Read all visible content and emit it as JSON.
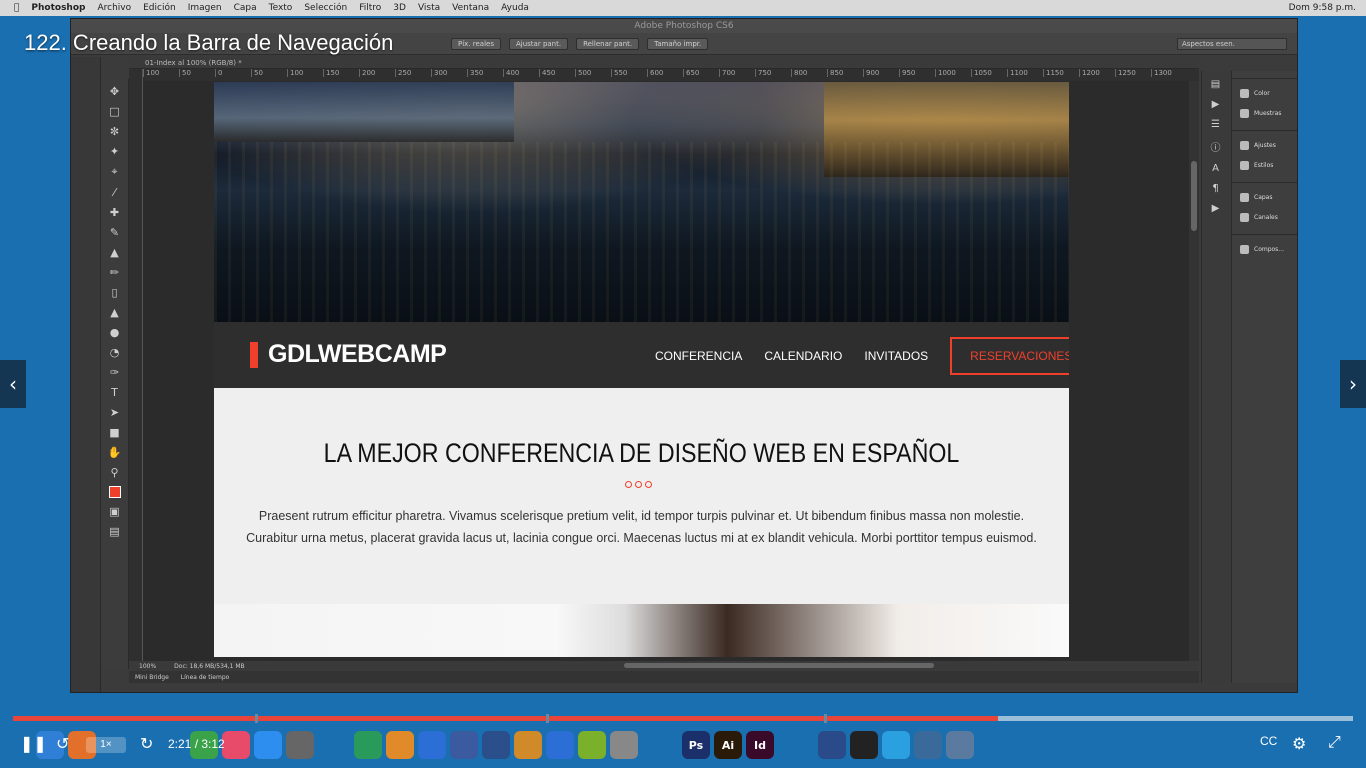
{
  "lesson_title": "122. Creando la Barra de Navegación",
  "menubar": {
    "app_name": "Photoshop",
    "items": [
      "Archivo",
      "Edición",
      "Imagen",
      "Capa",
      "Texto",
      "Selección",
      "Filtro",
      "3D",
      "Vista",
      "Ventana",
      "Ayuda"
    ],
    "clock": "Dom 9:58 p.m."
  },
  "photoshop": {
    "window_title": "Adobe Photoshop CS6",
    "options": {
      "btn1": "Píx. reales",
      "btn2": "Ajustar pant.",
      "btn3": "Rellenar pant.",
      "btn4": "Tamaño impr.",
      "workspace": "Aspectos esen."
    },
    "doc_tab": "01-Index al 100% (RGB/8) *",
    "ruler_ticks": [
      "100",
      "50",
      "0",
      "50",
      "100",
      "150",
      "200",
      "250",
      "300",
      "350",
      "400",
      "450",
      "500",
      "550",
      "600",
      "650",
      "700",
      "750",
      "800",
      "850",
      "900",
      "950",
      "1000",
      "1050",
      "1100",
      "1150",
      "1200",
      "1250",
      "1300"
    ],
    "status": {
      "zoom": "100%",
      "doc_size": "Doc: 18,6 MB/534,1 MB"
    },
    "bottom_tabs": [
      "Mini Bridge",
      "Línea de tiempo"
    ],
    "panels": [
      {
        "label": "Color",
        "icon": "color-wheel-icon"
      },
      {
        "label": "Muestras",
        "icon": "swatches-icon"
      },
      {
        "label": "Ajustes",
        "icon": "adjustments-icon"
      },
      {
        "label": "Estilos",
        "icon": "styles-icon"
      },
      {
        "label": "Capas",
        "icon": "layers-icon"
      },
      {
        "label": "Canales",
        "icon": "channels-icon"
      },
      {
        "label": "Compos...",
        "icon": "layer-comps-icon"
      }
    ],
    "foreground_color": "#f0402c"
  },
  "design": {
    "logo": "GDLWEBCAMP",
    "nav": [
      "CONFERENCIA",
      "CALENDARIO",
      "INVITADOS"
    ],
    "nav_cta": "RESERVACIONES",
    "headline": "LA MEJOR CONFERENCIA DE DISEÑO WEB EN ESPAÑOL",
    "paragraph": "Praesent rutrum efficitur pharetra. Vivamus scelerisque pretium velit, id tempor turpis pulvinar et. Ut bibendum finibus massa non molestie. Curabitur urna metus, placerat gravida lacus ut, lacinia congue orci. Maecenas luctus mi at ex blandit vehicula. Morbi porttitor tempus euismod.",
    "accent_color": "#f0402c"
  },
  "player": {
    "speed": "1×",
    "current_time": "2:21",
    "duration": "3:12",
    "progress_fraction": 0.735
  },
  "dock_apps": [
    "Finder",
    "Launchpad",
    "Safari",
    "Firefox",
    "Chrome",
    "Music",
    "App Store",
    "Preferences",
    "Source Tree",
    "Sublime",
    "VS Code",
    "Xcode",
    "VirtualBox",
    "Sequel",
    "Cyberduck",
    "Android Studio",
    "Tools",
    "Photoshop",
    "Illustrator",
    "InDesign",
    "Browser",
    "Terminal",
    "Skype",
    "Camtasia",
    "Audio"
  ]
}
